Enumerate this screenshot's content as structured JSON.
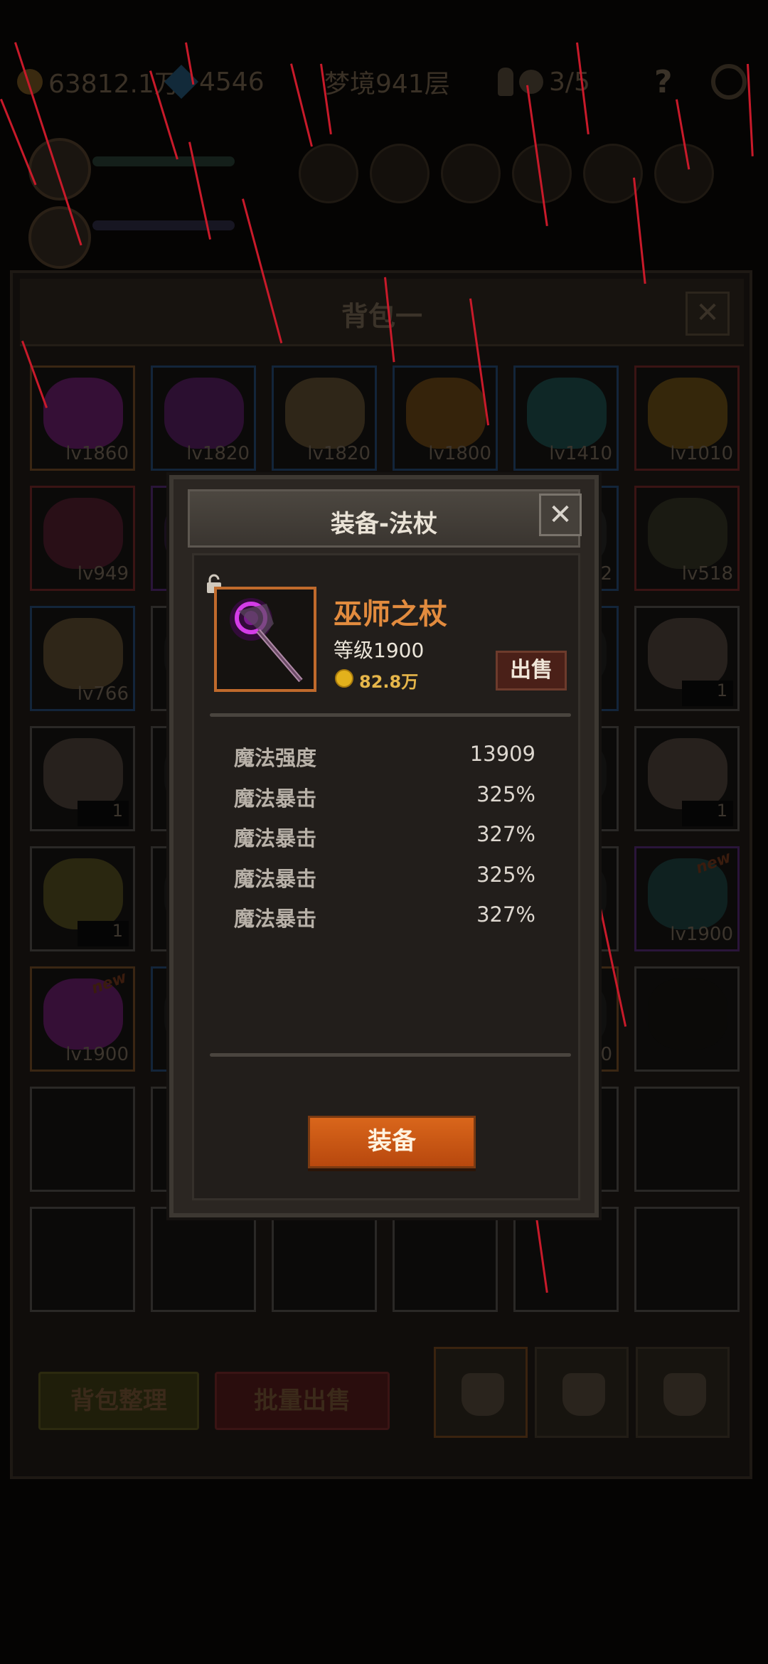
{
  "top_bar": {
    "gold": "63812.1万",
    "gems": "4546",
    "stage": "梦境941层",
    "keys": "3/5"
  },
  "bag": {
    "title": "背包一",
    "sort_button": "背包整理",
    "bulk_sell_button": "批量出售",
    "rows": [
      [
        {
          "lv": "lv1860",
          "rarity": "orange",
          "art": "#3a0f3c"
        },
        {
          "lv": "lv1820",
          "rarity": "blue",
          "art": "#2f0f35"
        },
        {
          "lv": "lv1820",
          "rarity": "blue",
          "art": "#33291b"
        },
        {
          "lv": "lv1800",
          "rarity": "blue",
          "art": "#3a260c"
        },
        {
          "lv": "lv1410",
          "rarity": "blue",
          "art": "#0f2a2a"
        },
        {
          "lv": "lv1010",
          "rarity": "red",
          "art": "#3a2a0c"
        }
      ],
      [
        {
          "lv": "lv949",
          "rarity": "red",
          "art": "#2c0f1a"
        },
        {
          "lv": "",
          "rarity": "purple",
          "art": "#1a0f20"
        },
        {
          "lv": "",
          "rarity": "gray",
          "art": "#111"
        },
        {
          "lv": "",
          "rarity": "gray",
          "art": "#111"
        },
        {
          "lv": "2",
          "rarity": "blue",
          "art": "#141414"
        },
        {
          "lv": "lv518",
          "rarity": "red",
          "art": "#1c1c14"
        }
      ],
      [
        {
          "lv": "lv766",
          "rarity": "blue",
          "art": "#33291b"
        },
        {
          "lv": "",
          "rarity": "gray",
          "art": "#111"
        },
        {
          "lv": "",
          "rarity": "gray",
          "art": "#111"
        },
        {
          "lv": "",
          "rarity": "gray",
          "art": "#111"
        },
        {
          "lv": "",
          "rarity": "blue",
          "art": "#111"
        },
        {
          "count": "1",
          "rarity": "gray",
          "art": "#2a2420"
        }
      ],
      [
        {
          "count": "1",
          "rarity": "gray",
          "art": "#2a2420"
        },
        {
          "lv": "",
          "rarity": "gray",
          "art": "#111"
        },
        {
          "lv": "",
          "rarity": "gray",
          "art": "#111"
        },
        {
          "lv": "",
          "rarity": "gray",
          "art": "#111"
        },
        {
          "lv": "",
          "rarity": "gray",
          "art": "#111"
        },
        {
          "count": "1",
          "rarity": "gray",
          "art": "#2a2420"
        }
      ],
      [
        {
          "count": "1",
          "rarity": "gray",
          "art": "#2e2a12"
        },
        {
          "lv": "",
          "rarity": "gray",
          "art": "#111"
        },
        {
          "lv": "",
          "rarity": "gray",
          "art": "#111"
        },
        {
          "lv": "",
          "rarity": "gray",
          "art": "#111"
        },
        {
          "lv": "",
          "rarity": "gray",
          "art": "#111"
        },
        {
          "lv": "lv1900",
          "rarity": "purple",
          "art": "#0f2424",
          "new": "new"
        }
      ],
      [
        {
          "lv": "lv1900",
          "rarity": "orange",
          "art": "#3a0f3c",
          "new": "new"
        },
        {
          "lv": "",
          "rarity": "blue",
          "art": "#111"
        },
        {
          "lv": "",
          "rarity": "gray",
          "art": "#111"
        },
        {
          "lv": "",
          "rarity": "gray",
          "art": "#111"
        },
        {
          "lv": "00",
          "rarity": "orange",
          "art": "#111"
        },
        {
          "lv": "",
          "rarity": "gray",
          "art": "#0b0a09"
        }
      ],
      [
        {
          "lv": "",
          "rarity": "gray",
          "art": ""
        },
        {
          "lv": "",
          "rarity": "gray",
          "art": ""
        },
        {
          "lv": "",
          "rarity": "gray",
          "art": ""
        },
        {
          "lv": "",
          "rarity": "gray",
          "art": ""
        },
        {
          "lv": "",
          "rarity": "gray",
          "art": ""
        },
        {
          "lv": "",
          "rarity": "gray",
          "art": ""
        }
      ],
      [
        {
          "lv": "",
          "rarity": "gray",
          "art": ""
        },
        {
          "lv": "",
          "rarity": "gray",
          "art": ""
        },
        {
          "lv": "",
          "rarity": "gray",
          "art": ""
        },
        {
          "lv": "",
          "rarity": "gray",
          "art": ""
        },
        {
          "lv": "",
          "rarity": "gray",
          "art": ""
        },
        {
          "lv": "",
          "rarity": "gray",
          "art": ""
        }
      ]
    ]
  },
  "dialog": {
    "title": "装备-法杖",
    "close_label": "✕",
    "item_name": "巫师之杖",
    "item_level": "等级1900",
    "price": "82.8万",
    "sell_button": "出售",
    "equip_button": "装备",
    "stats": [
      {
        "label": "魔法强度",
        "value": "13909"
      },
      {
        "label": "魔法暴击",
        "value": "325%"
      },
      {
        "label": "魔法暴击",
        "value": "327%"
      },
      {
        "label": "魔法暴击",
        "value": "325%"
      },
      {
        "label": "魔法暴击",
        "value": "327%"
      }
    ]
  },
  "colors": {
    "accent_orange": "#d9661b",
    "item_name": "#e28b3e",
    "rain": "#c81a2a"
  }
}
